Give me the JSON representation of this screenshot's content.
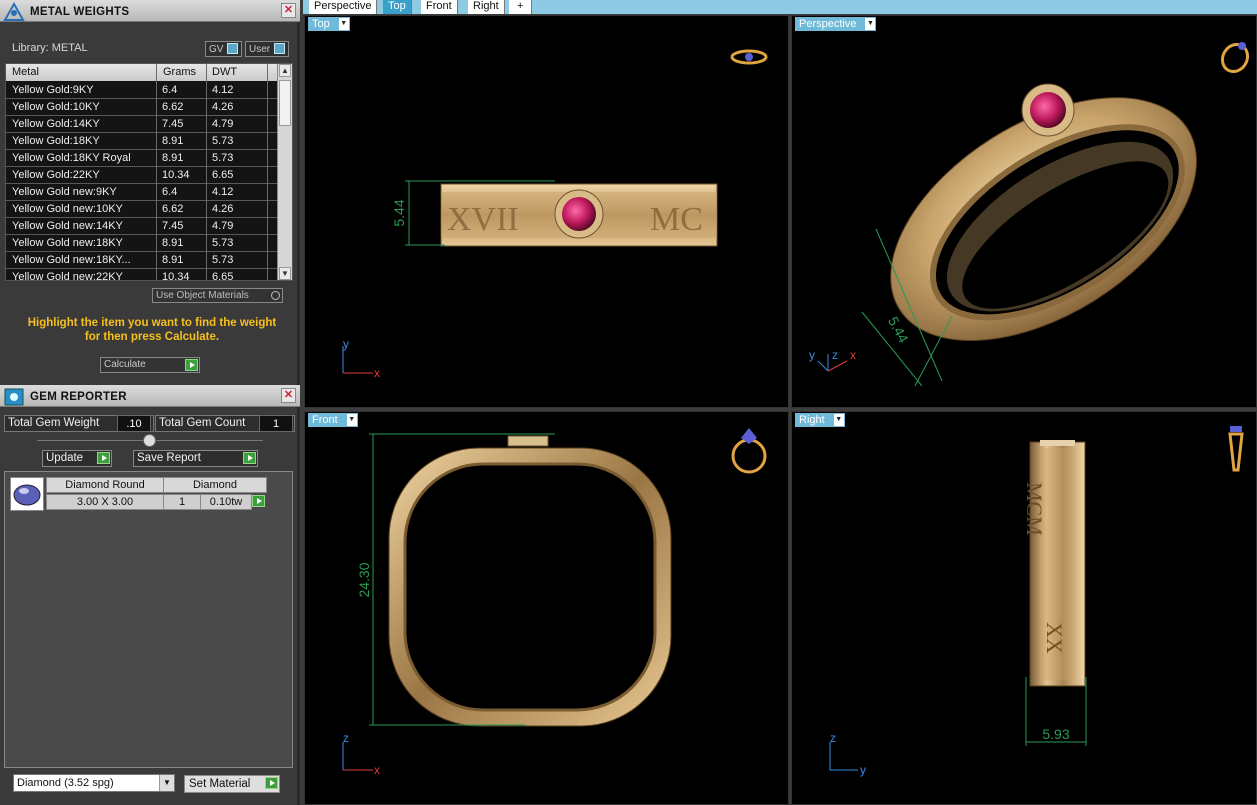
{
  "metal_panel": {
    "title": "METAL WEIGHTS",
    "close": "✕",
    "library_label": "Library: METAL",
    "gv_label": "GV",
    "user_label": "User",
    "columns": [
      "Metal",
      "Grams",
      "DWT"
    ],
    "rows": [
      {
        "metal": "Yellow Gold:9KY",
        "grams": "6.4",
        "dwt": "4.12"
      },
      {
        "metal": "Yellow Gold:10KY",
        "grams": "6.62",
        "dwt": "4.26"
      },
      {
        "metal": "Yellow Gold:14KY",
        "grams": "7.45",
        "dwt": "4.79"
      },
      {
        "metal": "Yellow Gold:18KY",
        "grams": "8.91",
        "dwt": "5.73"
      },
      {
        "metal": "Yellow Gold:18KY Royal",
        "grams": "8.91",
        "dwt": "5.73"
      },
      {
        "metal": "Yellow Gold:22KY",
        "grams": "10.34",
        "dwt": "6.65"
      },
      {
        "metal": "Yellow Gold new:9KY",
        "grams": "6.4",
        "dwt": "4.12"
      },
      {
        "metal": "Yellow Gold new:10KY",
        "grams": "6.62",
        "dwt": "4.26"
      },
      {
        "metal": "Yellow Gold new:14KY",
        "grams": "7.45",
        "dwt": "4.79"
      },
      {
        "metal": "Yellow Gold new:18KY",
        "grams": "8.91",
        "dwt": "5.73"
      },
      {
        "metal": "Yellow Gold new:18KY...",
        "grams": "8.91",
        "dwt": "5.73"
      },
      {
        "metal": "Yellow Gold new:22KY",
        "grams": "10.34",
        "dwt": "6.65"
      }
    ],
    "use_object_materials": "Use Object Materials",
    "hint_line1": "Highlight the item you want to find the weight",
    "hint_line2": "for then press Calculate.",
    "calculate_label": "Calculate"
  },
  "gem_panel": {
    "title": "GEM REPORTER",
    "close": "✕",
    "total_weight_label": "Total Gem Weight",
    "total_weight_value": ".10",
    "total_count_label": "Total Gem Count",
    "total_count_value": "1",
    "update_label": "Update",
    "save_report_label": "Save Report",
    "gems": [
      {
        "name": "Diamond Round",
        "size": "3.00 X 3.00",
        "material": "Diamond",
        "count": "1",
        "weight": "0.10tw"
      }
    ],
    "material_select": "Diamond    (3.52 spg)",
    "set_material_label": "Set Material"
  },
  "tabs": [
    {
      "label": "Perspective",
      "active": false
    },
    {
      "label": "Top",
      "active": true
    },
    {
      "label": "Front",
      "active": false
    },
    {
      "label": "Right",
      "active": false
    },
    {
      "label": "+",
      "active": false
    }
  ],
  "viewports": {
    "top": {
      "label": "Top",
      "dimension": "5.44",
      "axis_a": "y",
      "axis_b": "x"
    },
    "perspective": {
      "label": "Perspective",
      "dimension": "5.44",
      "axis_a": "y",
      "axis_b": "z",
      "axis_c": "x"
    },
    "front": {
      "label": "Front",
      "dimension": "24.30",
      "axis_a": "z",
      "axis_b": "x"
    },
    "right": {
      "label": "Right",
      "dimension": "5.93",
      "axis_a": "z",
      "axis_b": "y"
    }
  },
  "colors": {
    "accent_blue": "#6fbad8",
    "tab_active": "#39a0c9",
    "gold": "#c9a46b",
    "ruby": "#c01a5e",
    "dimension_green": "#2a9a55",
    "hint_yellow": "#f6c01e"
  }
}
